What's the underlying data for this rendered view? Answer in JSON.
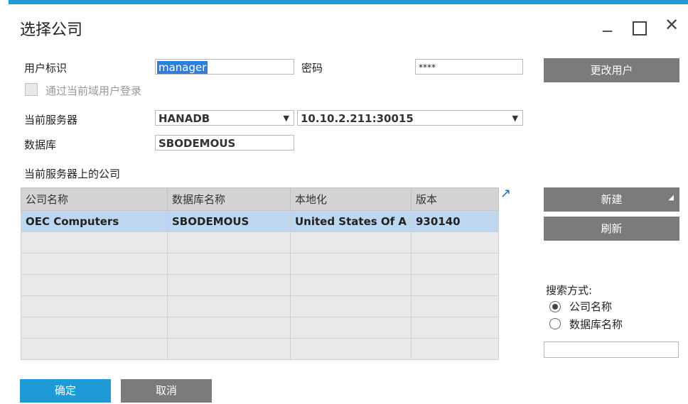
{
  "window": {
    "title": "选择公司"
  },
  "form": {
    "user_id_label": "用户标识",
    "user_id_value": "manager",
    "password_label": "密码",
    "password_value": "****",
    "change_user_button": "更改用户",
    "domain_login_label": "通过当前域用户登录",
    "current_server_label": "当前服务器",
    "server_type_value": "HANADB",
    "server_address_value": "10.10.2.211:30015",
    "database_label": "数据库",
    "database_value": "SBODEMOUS"
  },
  "companies": {
    "section_label": "当前服务器上的公司",
    "columns": [
      "公司名称",
      "数据库名称",
      "本地化",
      "版本"
    ],
    "rows": [
      [
        "OEC Computers",
        "SBODEMOUS",
        "United States Of A",
        "930140"
      ],
      [
        "",
        "",
        "",
        ""
      ],
      [
        "",
        "",
        "",
        ""
      ],
      [
        "",
        "",
        "",
        ""
      ],
      [
        "",
        "",
        "",
        ""
      ],
      [
        "",
        "",
        "",
        ""
      ],
      [
        "",
        "",
        "",
        ""
      ]
    ]
  },
  "side": {
    "new_button": "新建",
    "refresh_button": "刷新",
    "search_mode_label": "搜索方式:",
    "radio_company_name": "公司名称",
    "radio_database_name": "数据库名称",
    "search_value": ""
  },
  "footer": {
    "ok_button": "确定",
    "cancel_button": "取消"
  },
  "colors": {
    "accent": "#1e9bd7",
    "button_gray": "#7b7b7b",
    "selected_row": "#bcd7ef"
  },
  "icons": [
    "minimize-icon",
    "maximize-icon",
    "close-icon",
    "expand-arrow-icon",
    "dropdown-arrow-icon"
  ]
}
